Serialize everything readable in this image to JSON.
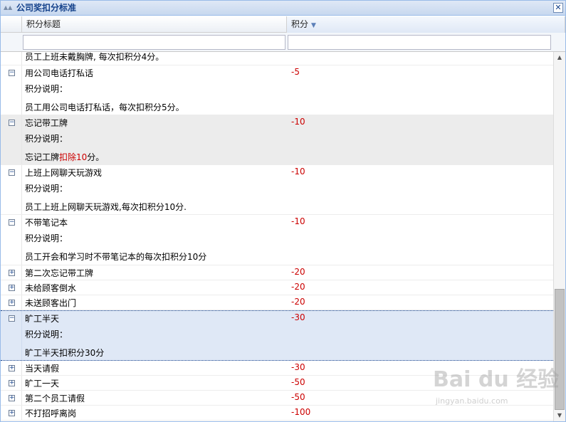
{
  "window": {
    "title": "公司奖扣分标准",
    "close_glyph": "✕"
  },
  "columns": {
    "title": "积分标题",
    "score": "积分"
  },
  "partial_top": "员工上班未戴胸牌, 每次扣积分4分。",
  "detail_label": "积分说明：",
  "rows": [
    {
      "title": "用公司电话打私话",
      "score": "-5",
      "desc": "员工用公司电话打私话，每次扣积分5分。"
    },
    {
      "title": "忘记带工牌",
      "score": "-10",
      "desc_pre": "忘记工牌",
      "desc_red": "扣除10",
      "desc_post": "分。"
    },
    {
      "title": "上班上网聊天玩游戏",
      "score": "-10",
      "desc": "员工上班上网聊天玩游戏,每次扣积分10分."
    },
    {
      "title": "不带笔记本",
      "score": "-10",
      "desc": "员工开会和学习时不带笔记本的每次扣积分10分"
    },
    {
      "title": "第二次忘记带工牌",
      "score": "-20"
    },
    {
      "title": "未给顾客倒水",
      "score": "-20"
    },
    {
      "title": "未送顾客出门",
      "score": "-20"
    },
    {
      "title": "旷工半天",
      "score": "-30",
      "desc": "旷工半天扣积分30分"
    },
    {
      "title": "当天请假",
      "score": "-30"
    },
    {
      "title": "旷工一天",
      "score": "-50"
    },
    {
      "title": "第二个员工请假",
      "score": "-50"
    },
    {
      "title": "不打招呼离岗",
      "score": "-100"
    }
  ],
  "watermark": {
    "main": "Bai du 经验",
    "sub": "jingyan.baidu.com"
  }
}
